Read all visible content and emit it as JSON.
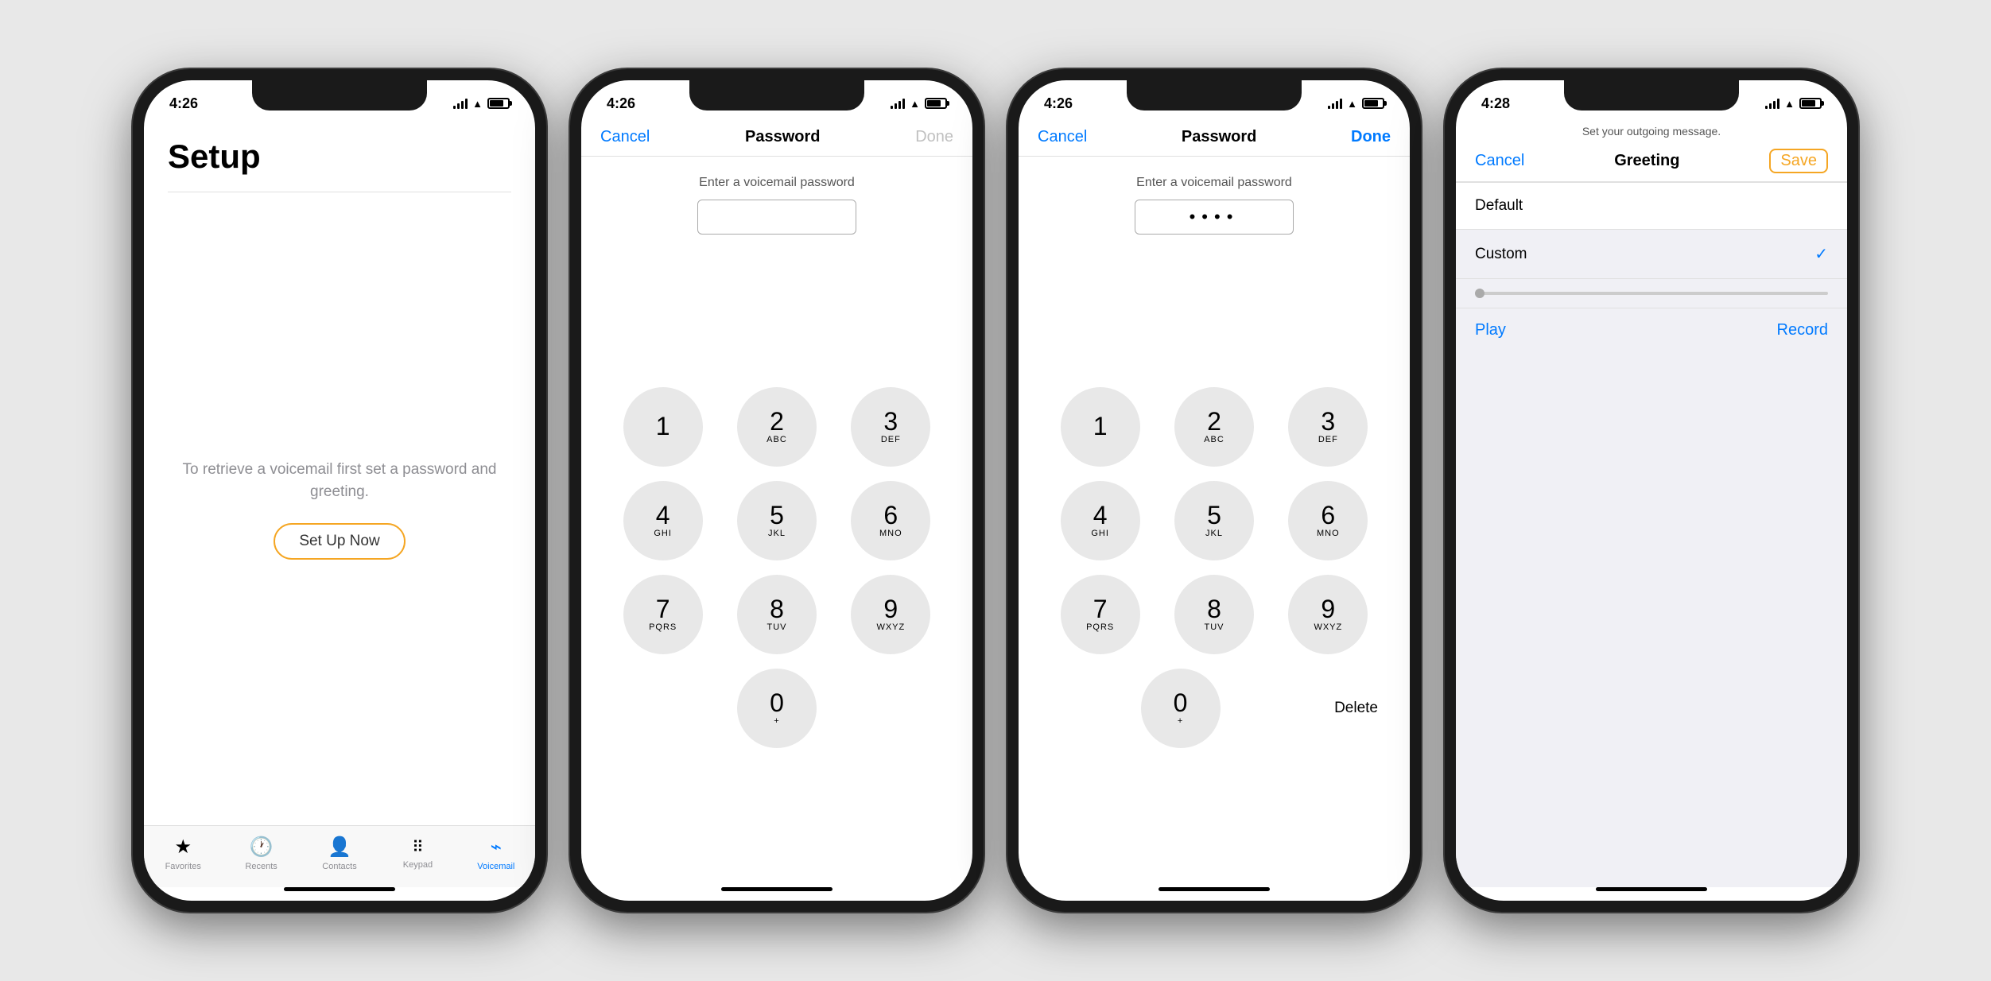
{
  "phones": [
    {
      "id": "phone1",
      "status": {
        "time": "4:26",
        "arrow": "↗",
        "signal": true,
        "wifi": true,
        "battery": true
      },
      "screen": "setup",
      "setup": {
        "title": "Setup",
        "instruction": "To retrieve a voicemail\nfirst set a password\nand greeting.",
        "button": "Set Up Now"
      },
      "tabs": [
        {
          "label": "Favorites",
          "icon": "★",
          "active": false
        },
        {
          "label": "Recents",
          "icon": "🕐",
          "active": false
        },
        {
          "label": "Contacts",
          "icon": "👤",
          "active": false
        },
        {
          "label": "Keypad",
          "icon": "⠿",
          "active": false
        },
        {
          "label": "Voicemail",
          "icon": "⌁",
          "active": true
        }
      ]
    },
    {
      "id": "phone2",
      "status": {
        "time": "4:26",
        "arrow": "↗"
      },
      "screen": "password",
      "nav": {
        "cancel": "Cancel",
        "title": "Password",
        "done": "Done",
        "doneActive": false
      },
      "password": {
        "label": "Enter a voicemail password",
        "value": ""
      },
      "keypad": [
        {
          "num": "1",
          "letters": ""
        },
        {
          "num": "2",
          "letters": "ABC"
        },
        {
          "num": "3",
          "letters": "DEF"
        },
        {
          "num": "4",
          "letters": "GHI"
        },
        {
          "num": "5",
          "letters": "JKL"
        },
        {
          "num": "6",
          "letters": "MNO"
        },
        {
          "num": "7",
          "letters": "PQRS"
        },
        {
          "num": "8",
          "letters": "TUV"
        },
        {
          "num": "9",
          "letters": "WXYZ"
        },
        {
          "num": "0",
          "letters": "+"
        }
      ]
    },
    {
      "id": "phone3",
      "status": {
        "time": "4:26",
        "arrow": "↗"
      },
      "screen": "password-filled",
      "nav": {
        "cancel": "Cancel",
        "title": "Password",
        "done": "Done",
        "doneActive": true
      },
      "password": {
        "label": "Enter a voicemail password",
        "value": "••••"
      },
      "deleteLabel": "Delete",
      "keypad": [
        {
          "num": "1",
          "letters": ""
        },
        {
          "num": "2",
          "letters": "ABC"
        },
        {
          "num": "3",
          "letters": "DEF"
        },
        {
          "num": "4",
          "letters": "GHI"
        },
        {
          "num": "5",
          "letters": "JKL"
        },
        {
          "num": "6",
          "letters": "MNO"
        },
        {
          "num": "7",
          "letters": "PQRS"
        },
        {
          "num": "8",
          "letters": "TUV"
        },
        {
          "num": "9",
          "letters": "WXYZ"
        },
        {
          "num": "0",
          "letters": "+"
        }
      ]
    },
    {
      "id": "phone4",
      "status": {
        "time": "4:28",
        "arrow": "↗"
      },
      "screen": "greeting",
      "greeting": {
        "subtitle": "Set your outgoing message.",
        "cancel": "Cancel",
        "title": "Greeting",
        "save": "Save",
        "options": [
          {
            "label": "Default",
            "selected": false
          },
          {
            "label": "Custom",
            "selected": true
          }
        ],
        "playLabel": "Play",
        "recordLabel": "Record"
      }
    }
  ]
}
